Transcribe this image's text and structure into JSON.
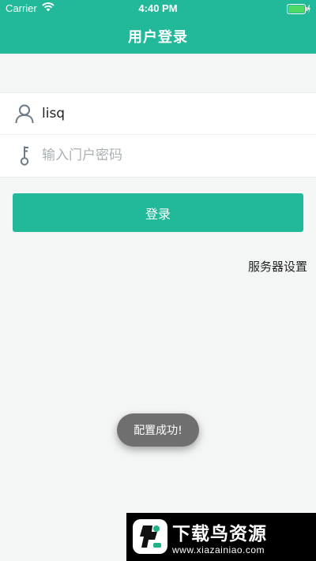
{
  "status_bar": {
    "carrier": "Carrier",
    "time": "4:40 PM"
  },
  "header": {
    "title": "用户登录",
    "color": "#22b99a"
  },
  "form": {
    "username": {
      "value": "lisq",
      "icon": "user-icon"
    },
    "password": {
      "value": "",
      "placeholder": "输入门户密码",
      "icon": "key-icon"
    }
  },
  "login_button": {
    "label": "登录"
  },
  "server_settings": {
    "label": "服务器设置"
  },
  "toast": {
    "message": "配置成功!"
  },
  "watermark": {
    "title": "下载鸟资源",
    "url": "www.xiazainiao.com"
  }
}
